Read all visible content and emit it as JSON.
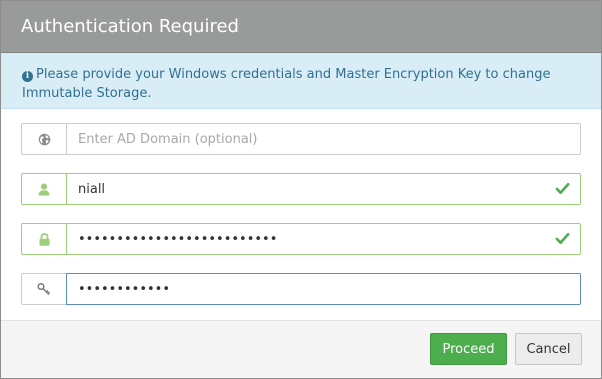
{
  "dialog": {
    "title": "Authentication Required",
    "info_message": "Please provide your Windows credentials and Master Encryption Key to change Immutable Storage."
  },
  "fields": {
    "domain": {
      "placeholder": "Enter AD Domain (optional)",
      "value": "",
      "icon": "globe-icon"
    },
    "username": {
      "value": "niall",
      "icon": "user-icon",
      "status": "valid"
    },
    "password": {
      "value": "••••••••••••••••••••••••••",
      "icon": "lock-icon",
      "status": "valid"
    },
    "encryption_key": {
      "value": "••••••••••••",
      "icon": "key-icon",
      "status": "focused"
    }
  },
  "buttons": {
    "proceed": "Proceed",
    "cancel": "Cancel"
  },
  "colors": {
    "header": "#999b9a",
    "info_bg": "#d9edf7",
    "info_text": "#31708f",
    "success": "#4cae4c",
    "valid_border": "#9bcf7a"
  }
}
